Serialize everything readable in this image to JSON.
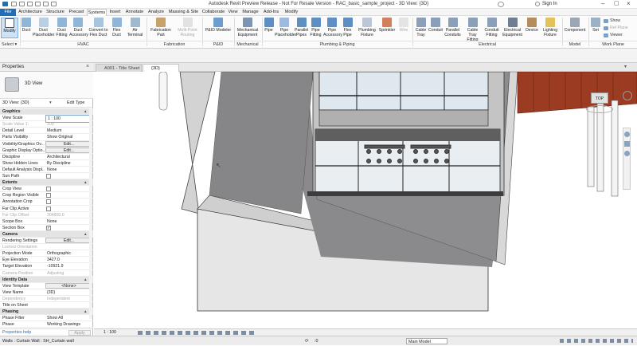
{
  "window": {
    "title": "Autodesk Revit Preview Release - Not For Resale Version - RAC_basic_sample_project - 3D View: {3D}",
    "search_placeholder": "",
    "sign_in": "Sign In"
  },
  "menu": {
    "tabs": [
      "File",
      "Architecture",
      "Structure",
      "Precast",
      "Systems",
      "Insert",
      "Annotate",
      "Analyze",
      "Massing & Site",
      "Collaborate",
      "View",
      "Manage",
      "Add-Ins",
      "Modify"
    ],
    "active": "Systems"
  },
  "ribbon": {
    "modify": "Modify",
    "select_label": "Select ▾",
    "hvac": {
      "buttons": [
        "Duct",
        "Duct Placeholder",
        "Duct Fitting",
        "Duct Accessory",
        "Convert to Flex Duct",
        "Flex Duct",
        "Air Terminal"
      ],
      "label": "HVAC"
    },
    "fabrication": {
      "buttons": [
        "Fabrication Part",
        "Multi-Point Routing"
      ],
      "label": "Fabrication"
    },
    "pid": {
      "buttons": [
        "P&ID Modeler"
      ],
      "label": "P&ID Collaboration"
    },
    "mechanical": {
      "buttons": [
        "Mechanical Equipment"
      ],
      "label": "Mechanical"
    },
    "plumbing": {
      "buttons": [
        "Pipe",
        "Pipe Placeholder",
        "Parallel Pipes",
        "Pipe Fitting",
        "Pipe Accessory",
        "Flex Pipe",
        "Plumbing Fixture",
        "Sprinkler",
        "Wire"
      ],
      "label": "Plumbing & Piping"
    },
    "electrical": {
      "buttons": [
        "Cable Tray",
        "Conduit",
        "Parallel Conduits",
        "Cable Tray Fitting",
        "Conduit Fitting",
        "Electrical Equipment",
        "Device",
        "Lighting Fixture"
      ],
      "label": "Electrical"
    },
    "model": {
      "buttons": [
        "Component"
      ],
      "label": "Model"
    },
    "workplane": {
      "buttons": [
        "Set",
        "Show",
        "Ref Plane",
        "Viewer"
      ],
      "label": "Work Plane"
    }
  },
  "doc_tabs": [
    "A001 - Title Sheet",
    "{3D}"
  ],
  "properties": {
    "title": "Properties",
    "type_name": "3D View",
    "selector": "3D View: {3D}",
    "edit_type": "Edit Type",
    "rows": [
      {
        "k": "Graphics",
        "v": "",
        "type": "group"
      },
      {
        "k": "View Scale",
        "v": "1 : 100",
        "type": "input"
      },
      {
        "k": "Scale Value    1:",
        "v": "100",
        "type": "dim"
      },
      {
        "k": "Detail Level",
        "v": "Medium"
      },
      {
        "k": "Parts Visibility",
        "v": "Show Original"
      },
      {
        "k": "Visibility/Graphics Ov...",
        "v": "Edit...",
        "type": "button"
      },
      {
        "k": "Graphic Display Optio...",
        "v": "Edit...",
        "type": "button"
      },
      {
        "k": "Discipline",
        "v": "Architectural"
      },
      {
        "k": "Show Hidden Lines",
        "v": "By Discipline"
      },
      {
        "k": "Default Analysis Displ...",
        "v": "None"
      },
      {
        "k": "Sun Path",
        "v": "",
        "type": "check"
      },
      {
        "k": "Extents",
        "v": "",
        "type": "group"
      },
      {
        "k": "Crop View",
        "v": "",
        "type": "check"
      },
      {
        "k": "Crop Region Visible",
        "v": "",
        "type": "check"
      },
      {
        "k": "Annotation Crop",
        "v": "",
        "type": "check"
      },
      {
        "k": "Far Clip Active",
        "v": "",
        "type": "check"
      },
      {
        "k": "Far Clip Offset",
        "v": "304800.0",
        "type": "dim"
      },
      {
        "k": "Scope Box",
        "v": "None"
      },
      {
        "k": "Section Box",
        "v": "✓",
        "type": "check"
      },
      {
        "k": "Camera",
        "v": "",
        "type": "group"
      },
      {
        "k": "Rendering Settings",
        "v": "Edit...",
        "type": "button"
      },
      {
        "k": "Locked Orientation",
        "v": "",
        "type": "dim"
      },
      {
        "k": "Projection Mode",
        "v": "Orthographic"
      },
      {
        "k": "Eye Elevation",
        "v": "3427.0"
      },
      {
        "k": "Target Elevation",
        "v": "-10921.9"
      },
      {
        "k": "Camera Position",
        "v": "Adjusting",
        "type": "dim"
      },
      {
        "k": "Identity Data",
        "v": "",
        "type": "group"
      },
      {
        "k": "View Template",
        "v": "<None>",
        "type": "button"
      },
      {
        "k": "View Name",
        "v": "{3D}"
      },
      {
        "k": "Dependency",
        "v": "Independent",
        "type": "dim"
      },
      {
        "k": "Title on Sheet",
        "v": ""
      },
      {
        "k": "Phasing",
        "v": "",
        "type": "group"
      },
      {
        "k": "Phase Filter",
        "v": "Show All"
      },
      {
        "k": "Phase",
        "v": "Working Drawings"
      }
    ],
    "help_link": "Properties help",
    "apply": "Apply"
  },
  "view_control": {
    "scale": "1 : 100"
  },
  "status": {
    "text": "Walls : Curtain Wall : SH_Curtain wall",
    "coord": ":0",
    "model": "Main Model"
  },
  "viewcube": {
    "label": "TOP"
  },
  "colors": {
    "accent": "#1f6fb8",
    "ribbon_bg": "#fbfbfb"
  }
}
